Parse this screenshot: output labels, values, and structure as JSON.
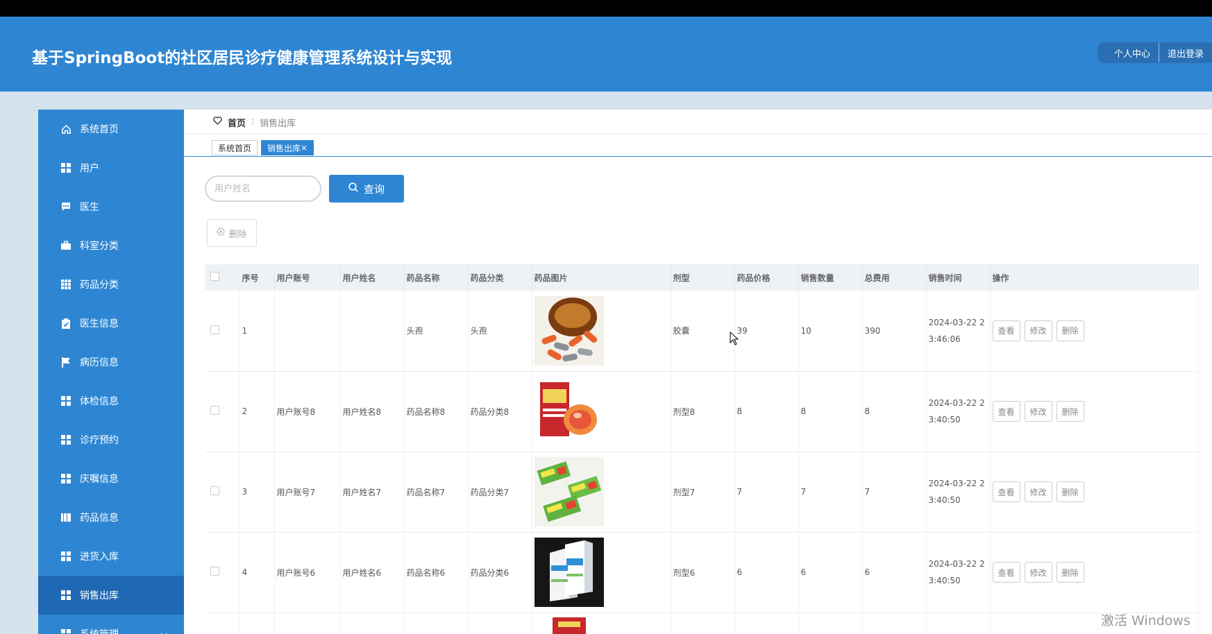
{
  "header": {
    "title": "基于SpringBoot的社区居民诊疗健康管理系统设计与实现",
    "profile_label": "个人中心",
    "logout_label": "退出登录"
  },
  "sidebar": {
    "items": [
      {
        "label": "系统首页",
        "icon": "home-icon"
      },
      {
        "label": "用户",
        "icon": "grid-icon"
      },
      {
        "label": "医生",
        "icon": "chat-icon"
      },
      {
        "label": "科室分类",
        "icon": "briefcase-icon"
      },
      {
        "label": "药品分类",
        "icon": "grid-icon"
      },
      {
        "label": "医生信息",
        "icon": "clipboard-icon"
      },
      {
        "label": "病历信息",
        "icon": "flag-icon"
      },
      {
        "label": "体检信息",
        "icon": "grid-icon"
      },
      {
        "label": "诊疗预约",
        "icon": "grid-icon"
      },
      {
        "label": "庆嘱信息",
        "icon": "grid-icon"
      },
      {
        "label": "药品信息",
        "icon": "book-icon"
      },
      {
        "label": "进货入库",
        "icon": "grid-icon"
      },
      {
        "label": "销售出库",
        "icon": "grid-icon",
        "active": true
      },
      {
        "label": "系统管理",
        "icon": "grid-icon"
      }
    ]
  },
  "breadcrumb": {
    "home": "首页",
    "separator": "⁝",
    "current": "销售出库"
  },
  "tabs": [
    {
      "label": "系统首页"
    },
    {
      "label": "销售出库",
      "active": true,
      "close": "×"
    }
  ],
  "search": {
    "placeholder": "用户姓名",
    "button_label": "查询"
  },
  "delete_button_label": "删除",
  "table": {
    "headers": [
      "序号",
      "用户账号",
      "用户姓名",
      "药品名称",
      "药品分类",
      "药品图片",
      "剂型",
      "药品价格",
      "销售数量",
      "总费用",
      "销售时间",
      "操作"
    ],
    "rows": [
      {
        "index": "1",
        "account": "",
        "name": "",
        "drug": "头孢",
        "category": "头孢",
        "image": "capsules-bottle",
        "form": "胶囊",
        "price": "39",
        "qty": "10",
        "total": "390",
        "time_line1": "2024-03-22 2",
        "time_line2": "3:46:06"
      },
      {
        "index": "2",
        "account": "用户账号8",
        "name": "用户姓名8",
        "drug": "药品名称8",
        "category": "药品分类8",
        "image": "red-box-tin",
        "form": "剂型8",
        "price": "8",
        "qty": "8",
        "total": "8",
        "time_line1": "2024-03-22 2",
        "time_line2": "3:40:50"
      },
      {
        "index": "3",
        "account": "用户账号7",
        "name": "用户姓名7",
        "drug": "药品名称7",
        "category": "药品分类7",
        "image": "green-packs",
        "form": "剂型7",
        "price": "7",
        "qty": "7",
        "total": "7",
        "time_line1": "2024-03-22 2",
        "time_line2": "3:40:50"
      },
      {
        "index": "4",
        "account": "用户账号6",
        "name": "用户姓名6",
        "drug": "药品名称6",
        "category": "药品分类6",
        "image": "white-boxes",
        "form": "剂型6",
        "price": "6",
        "qty": "6",
        "total": "6",
        "time_line1": "2024-03-22 2",
        "time_line2": "3:40:50"
      }
    ],
    "actions": {
      "view": "查看",
      "edit": "修改",
      "delete": "删除"
    }
  },
  "watermark": "激活 Windows",
  "colors": {
    "primary": "#2e86d3",
    "active_nav": "#1f68b4"
  }
}
